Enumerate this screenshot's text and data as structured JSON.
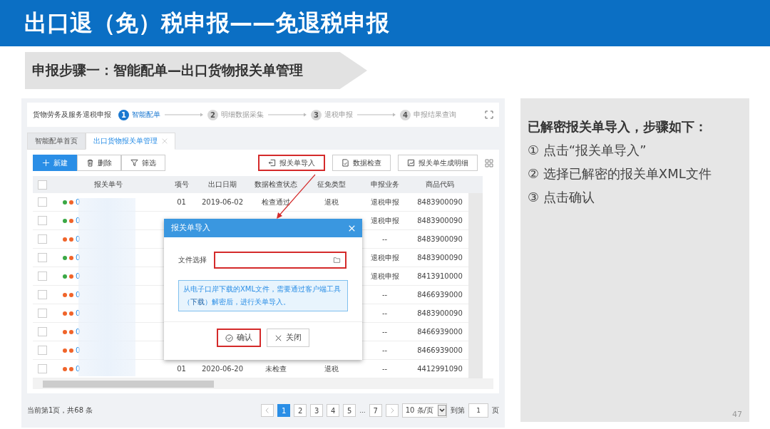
{
  "slide": {
    "title": "出口退（免）税申报——免退税申报",
    "subtitle": "申报步骤一：智能配单—出口货物报关单管理",
    "page_number": "47"
  },
  "app": {
    "breadcrumb": "货物劳务及服务退税申报",
    "steps": [
      {
        "number": "1",
        "label": "智能配单",
        "selected": true
      },
      {
        "number": "2",
        "label": "明细数据采集",
        "selected": false
      },
      {
        "number": "3",
        "label": "退税申报",
        "selected": false
      },
      {
        "number": "4",
        "label": "申报结果查询",
        "selected": false
      }
    ],
    "tabs": [
      {
        "label": "智能配单首页",
        "selected": false,
        "closable": false
      },
      {
        "label": "出口货物报关单管理",
        "selected": true,
        "closable": true
      }
    ],
    "toolbar_left": [
      {
        "label": "新建",
        "primary": true
      },
      {
        "label": "删除",
        "primary": false
      },
      {
        "label": "筛选",
        "primary": false
      }
    ],
    "toolbar_right": [
      {
        "label": "报关单导入",
        "highlighted": true
      },
      {
        "label": "数据检查",
        "highlighted": false
      },
      {
        "label": "报关单生成明细",
        "highlighted": false
      }
    ],
    "table": {
      "select_all_checked": false,
      "columns": [
        "报关单号",
        "项号",
        "出口日期",
        "数据检查状态",
        "征免类型",
        "申报业务",
        "商品代码"
      ],
      "rows": [
        {
          "checked": false,
          "dots": [
            {
              "color": "#3aa845"
            },
            {
              "color": "#f0642a"
            }
          ],
          "cells": {
            "number": "0",
            "item": "01",
            "date": "2019-06-02",
            "status": "检查通过",
            "levy": "退税",
            "business": "退税申报",
            "code": "8483900090"
          }
        },
        {
          "checked": false,
          "dots": [
            {
              "color": "#3aa845"
            },
            {
              "color": "#f0642a"
            }
          ],
          "cells": {
            "number": "0",
            "business": "退税申报",
            "code": "8483900090"
          }
        },
        {
          "checked": false,
          "dots": [
            {
              "color": "#f0642a"
            },
            {
              "color": "#f0642a"
            }
          ],
          "cells": {
            "number": "0",
            "business": "--",
            "code": "8483900090"
          }
        },
        {
          "checked": false,
          "dots": [
            {
              "color": "#3aa845"
            },
            {
              "color": "#f0642a"
            }
          ],
          "cells": {
            "number": "0",
            "business": "退税申报",
            "code": "8483900090"
          }
        },
        {
          "checked": false,
          "dots": [
            {
              "color": "#3aa845"
            },
            {
              "color": "#f0642a"
            }
          ],
          "cells": {
            "number": "0",
            "business": "退税申报",
            "code": "8413910000"
          }
        },
        {
          "checked": false,
          "dots": [
            {
              "color": "#f0642a"
            },
            {
              "color": "#f0642a"
            }
          ],
          "cells": {
            "number": "0",
            "business": "--",
            "code": "8466939000"
          }
        },
        {
          "checked": false,
          "dots": [
            {
              "color": "#f0642a"
            },
            {
              "color": "#f0642a"
            }
          ],
          "cells": {
            "number": "0",
            "business": "--",
            "code": "8483900090"
          }
        },
        {
          "checked": false,
          "dots": [
            {
              "color": "#f0642a"
            },
            {
              "color": "#f0642a"
            }
          ],
          "cells": {
            "number": "0",
            "business": "--",
            "code": "8466939000"
          }
        },
        {
          "checked": false,
          "dots": [
            {
              "color": "#f0642a"
            },
            {
              "color": "#f0642a"
            }
          ],
          "cells": {
            "number": "0",
            "business": "--",
            "code": "8466939000"
          }
        },
        {
          "checked": false,
          "dots": [
            {
              "color": "#f0642a"
            },
            {
              "color": "#f0642a"
            }
          ],
          "cells": {
            "number": "0",
            "item": "01",
            "date": "2020-06-20",
            "status": "未检查",
            "levy": "退税",
            "business": "--",
            "code": "4412991090"
          }
        }
      ]
    },
    "pagination": {
      "summary": "当前第1页，共68 条",
      "pages": [
        {
          "kind": "page",
          "label": "1",
          "selected": true
        },
        {
          "kind": "page",
          "label": "2",
          "selected": false
        },
        {
          "kind": "page",
          "label": "3",
          "selected": false
        },
        {
          "kind": "page",
          "label": "4",
          "selected": false
        },
        {
          "kind": "page",
          "label": "5",
          "selected": false
        },
        {
          "kind": "ellipsis",
          "label": "..."
        },
        {
          "kind": "page",
          "label": "7",
          "selected": false
        }
      ],
      "page_size": "10 条/页",
      "goto_label": "到第",
      "goto_value": "1",
      "page_suffix": "页"
    },
    "dialog": {
      "title": "报关单导入",
      "field_label": "文件选择",
      "field_highlighted": true,
      "notice": "从电子口岸下载的XML文件，需要通过客户端工具（**下载**）解密后，进行关单导入。",
      "buttons": [
        {
          "label": "确认",
          "highlighted": true
        },
        {
          "label": "关闭",
          "highlighted": false
        }
      ]
    }
  },
  "instructions": {
    "heading": "已解密报关单导入，步骤如下：",
    "steps": [
      "① 点击“报关单导入”",
      "② 选择已解密的报关单XML文件",
      "③ 点击确认"
    ]
  }
}
